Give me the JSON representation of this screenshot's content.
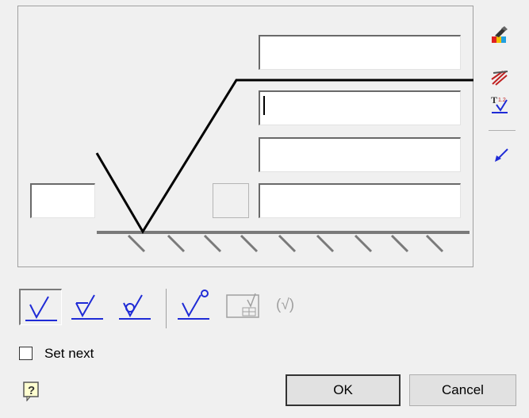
{
  "icons": {
    "side_top": "paintbrush-icon",
    "side_second": "multi-leader-icon",
    "side_third": "text-symbol-icon",
    "side_fourth": "leader-arrow-icon",
    "help": "help-icon"
  },
  "toolbar": {
    "buttons": [
      {
        "name": "basic-surface-symbol",
        "active": true
      },
      {
        "name": "material-removal-symbol",
        "active": false
      },
      {
        "name": "no-removal-symbol",
        "active": false
      },
      {
        "name": "all-around-symbol",
        "active": false
      },
      {
        "name": "general-symbol",
        "active": false,
        "disabled": true
      },
      {
        "name": "bracketed-symbol",
        "active": false,
        "disabled": true
      }
    ],
    "bracketed_label": "(√)"
  },
  "options": {
    "set_next_label": "Set next",
    "set_next_checked": false
  },
  "buttons": {
    "ok_label": "OK",
    "cancel_label": "Cancel"
  },
  "colors": {
    "symbol_blue": "#1f2bd6",
    "disabled_gray": "#a0a0a0"
  }
}
